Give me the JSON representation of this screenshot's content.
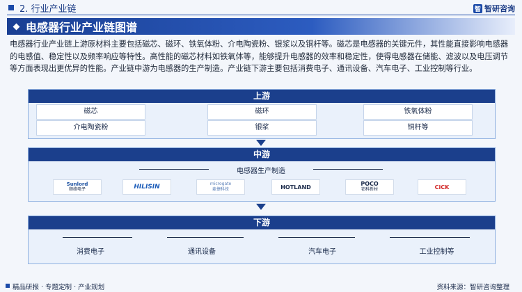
{
  "header": {
    "section": "2. 行业产业链",
    "brand": "智研咨询",
    "brand_logo": "智"
  },
  "banner_title": "电感器行业产业链图谱",
  "description": "电感器行业产业链上游原材料主要包括磁芯、磁环、铁氧体粉、介电陶瓷粉、银浆以及铜杆等。磁芯是电感器的关键元件，其性能直接影响电感器的电感值、稳定性以及频率响应等特性。高性能的磁芯材料如铁氧体等，能够提升电感器的效率和稳定性，使得电感器在储能、滤波以及电压调节等方面表现出更优异的性能。产业链中游为电感器的生产制造。产业链下游主要包括消费电子、通讯设备、汽车电子、工业控制等行业。",
  "upstream": {
    "title": "上游",
    "items": [
      "磁芯",
      "磁环",
      "铁氧体粉",
      "介电陶瓷粉",
      "银浆",
      "铜杆等"
    ]
  },
  "midstream": {
    "title": "中游",
    "subtitle": "电感器生产制造",
    "companies": [
      {
        "name": "Sunlord",
        "sub": "顺络电子",
        "color": "#1a4fa0"
      },
      {
        "name": "HILISIN",
        "sub": "",
        "color": "#1a5bb8"
      },
      {
        "name": "microgate",
        "sub": "麦捷科技",
        "color": "#5a7fb8"
      },
      {
        "name": "HOTLAND",
        "sub": "",
        "color": "#202020"
      },
      {
        "name": "POCO",
        "sub": "铂科新材",
        "color": "#202020"
      },
      {
        "name": "CiCK",
        "sub": "",
        "color": "#d02020"
      }
    ]
  },
  "downstream": {
    "title": "下游",
    "items": [
      "消费电子",
      "通讯设备",
      "汽车电子",
      "工业控制等"
    ]
  },
  "footer": {
    "left": "精品研报 · 专题定制 · 产业规划",
    "right": "资料来源：智研咨询整理"
  }
}
